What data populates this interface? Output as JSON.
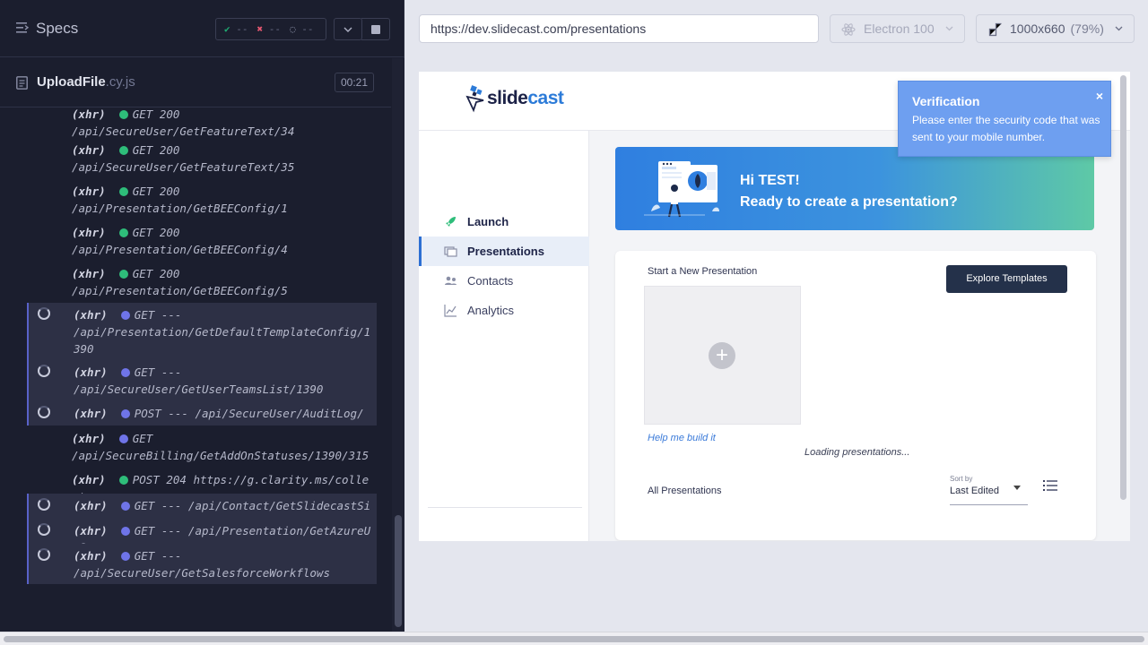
{
  "runner": {
    "title": "Specs",
    "stats": {
      "passed": "--",
      "failed": "--",
      "pending": "--"
    },
    "spec": {
      "name": "UploadFile",
      "ext": ".cy.js",
      "duration": "00:21"
    },
    "log": [
      {
        "tag": "(xhr)",
        "dot": "green",
        "method": "GET",
        "status": "200",
        "url": "/api/SecureUser/GetFeatureText/34",
        "pending": false
      },
      {
        "tag": "(xhr)",
        "dot": "green",
        "method": "GET",
        "status": "200",
        "url": "/api/SecureUser/GetFeatureText/35",
        "pending": false
      },
      {
        "tag": "(xhr)",
        "dot": "green",
        "method": "GET",
        "status": "200",
        "url": "/api/Presentation/GetBEEConfig/1",
        "pending": false
      },
      {
        "tag": "(xhr)",
        "dot": "green",
        "method": "GET",
        "status": "200",
        "url": "/api/Presentation/GetBEEConfig/4",
        "pending": false
      },
      {
        "tag": "(xhr)",
        "dot": "green",
        "method": "GET",
        "status": "200",
        "url": "/api/Presentation/GetBEEConfig/5",
        "pending": false
      },
      {
        "tag": "(xhr)",
        "dot": "blue",
        "method": "GET",
        "status": "---",
        "url": "/api/Presentation/GetDefaultTemplateConfig/1390",
        "pending": true
      },
      {
        "tag": "(xhr)",
        "dot": "blue",
        "method": "GET",
        "status": "---",
        "url": "/api/SecureUser/GetUserTeamsList/1390",
        "pending": true
      },
      {
        "tag": "(xhr)",
        "dot": "blue",
        "method": "POST",
        "status": "---",
        "url": "/api/SecureUser/AuditLog/",
        "pending": true
      },
      {
        "tag": "(xhr)",
        "dot": "blue",
        "method": "GET",
        "status": "",
        "url": "/api/SecureBilling/GetAddOnStatuses/1390/315",
        "pending": false
      },
      {
        "tag": "(xhr)",
        "dot": "green",
        "method": "POST",
        "status": "204",
        "url": "https://g.clarity.ms/collect",
        "pending": false
      },
      {
        "tag": "(xhr)",
        "dot": "blue",
        "method": "GET",
        "status": "---",
        "url": "/api/Contact/GetSlidecastSite",
        "pending": true
      },
      {
        "tag": "(xhr)",
        "dot": "blue",
        "method": "GET",
        "status": "---",
        "url": "/api/Presentation/GetAzureUrl",
        "pending": true
      },
      {
        "tag": "(xhr)",
        "dot": "blue",
        "method": "GET",
        "status": "---",
        "url": "/api/SecureUser/GetSalesforceWorkflows",
        "pending": true
      }
    ]
  },
  "browser": {
    "url": "https://dev.slidecast.com/presentations",
    "engine": "Electron 100",
    "viewport": "1000x660",
    "scale": "(79%)"
  },
  "app": {
    "logo": {
      "part1": "slide",
      "part2": "cast"
    },
    "nav": [
      {
        "label": "Launch",
        "icon": "rocket-icon",
        "active": false
      },
      {
        "label": "Presentations",
        "icon": "slides-icon",
        "active": true
      },
      {
        "label": "Contacts",
        "icon": "people-icon",
        "active": false
      },
      {
        "label": "Analytics",
        "icon": "chart-icon",
        "active": false
      }
    ],
    "banner": {
      "line1": "Hi TEST!",
      "line2": "Ready to create a presentation?"
    },
    "card": {
      "start_label": "Start a New Presentation",
      "explore_button": "Explore Templates",
      "help_link": "Help me build it",
      "loading": "Loading presentations...",
      "all_label": "All Presentations",
      "sort_label": "Sort by",
      "sort_value": "Last Edited"
    },
    "toast": {
      "title": "Verification",
      "message": "Please enter the security code that was sent to your mobile number.",
      "close": "×"
    }
  },
  "colors": {
    "runner_bg": "#1b1e2e",
    "accent_blue": "#2d6fd3",
    "toast_bg": "#6e9ff0",
    "pass": "#1fa971",
    "fail": "#e45770"
  }
}
